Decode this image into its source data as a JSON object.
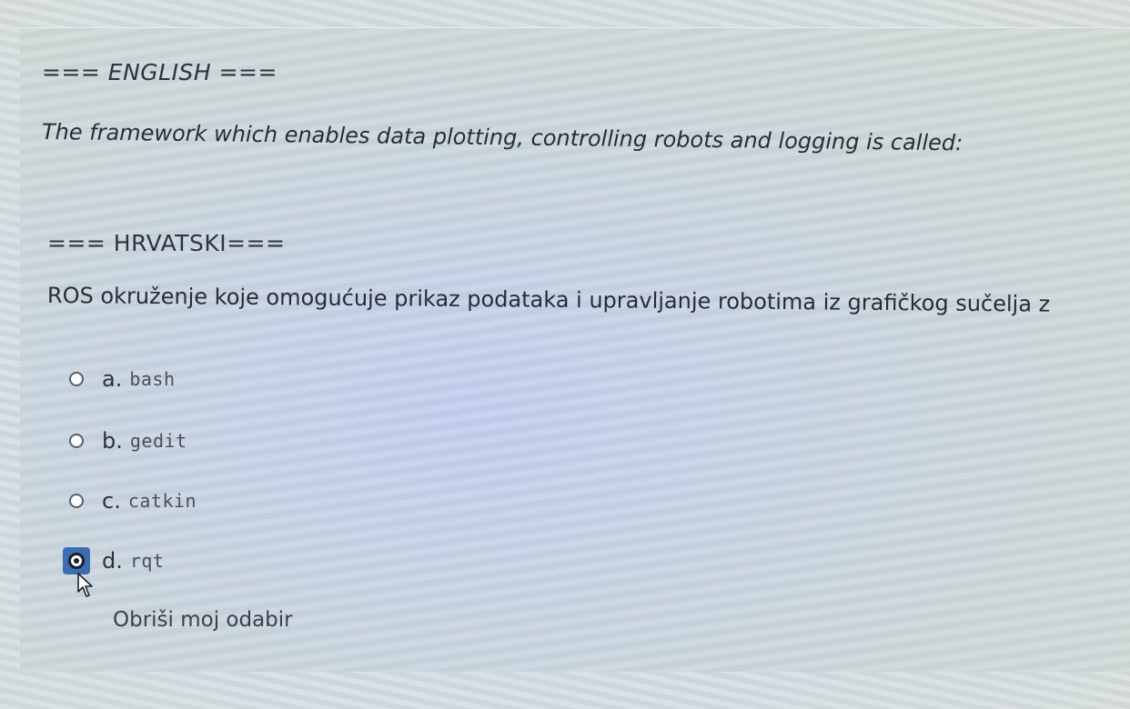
{
  "english_section": {
    "heading": "=== ENGLISH ===",
    "question": "The framework which enables data plotting, controlling robots and logging is called:"
  },
  "croatian_section": {
    "heading": "=== HRVATSKI===",
    "question": "ROS okruženje koje omogućuje prikaz podataka i upravljanje robotima iz grafičkog sučelja z"
  },
  "options": [
    {
      "letter": "a.",
      "code": "bash",
      "selected": false
    },
    {
      "letter": "b.",
      "code": "gedit",
      "selected": false
    },
    {
      "letter": "c.",
      "code": "catkin",
      "selected": false
    },
    {
      "letter": "d.",
      "code": "rqt",
      "selected": true
    }
  ],
  "clear_choice_label": "Obriši moj odabir",
  "colors": {
    "selected_highlight": "#3f6db4"
  }
}
